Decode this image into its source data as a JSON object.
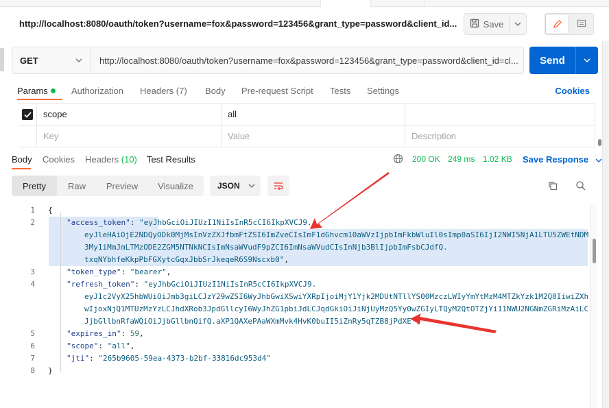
{
  "title_url": "http://localhost:8080/oauth/token?username=fox&password=123456&grant_type=password&client_id...",
  "toolbar": {
    "save_label": "Save"
  },
  "request": {
    "method": "GET",
    "url": "http://localhost:8080/oauth/token?username=fox&password=123456&grant_type=password&client_id=cl...",
    "send_label": "Send"
  },
  "request_tabs": {
    "params": "Params",
    "authorization": "Authorization",
    "headers": "Headers",
    "headers_count": "(7)",
    "body": "Body",
    "prerequest": "Pre-request Script",
    "tests": "Tests",
    "settings": "Settings",
    "cookies": "Cookies"
  },
  "params": {
    "rows": [
      {
        "key": "scope",
        "value": "all",
        "description": ""
      }
    ],
    "placeholders": {
      "key": "Key",
      "value": "Value",
      "description": "Description"
    }
  },
  "response_tabs": {
    "body": "Body",
    "cookies": "Cookies",
    "headers": "Headers",
    "headers_count": "(10)",
    "test_results": "Test Results"
  },
  "response_status": {
    "status": "200 OK",
    "time": "249 ms",
    "size": "1.02 KB",
    "save_response": "Save Response"
  },
  "view_modes": {
    "pretty": "Pretty",
    "raw": "Raw",
    "preview": "Preview",
    "visualize": "Visualize",
    "format": "JSON"
  },
  "colors": {
    "accent": "#ff6c37",
    "send": "#0265d2",
    "status_ok": "#0cbb52",
    "highlight": "#dde9f8",
    "arrow": "#e8342e"
  },
  "code": {
    "line_numbers": [
      "1",
      "2",
      "3",
      "4",
      "5",
      "6",
      "7",
      "8"
    ],
    "open_brace": "{",
    "close_brace": "}",
    "access_key": "\"access_token\"",
    "access_lines": [
      "\"eyJhbGciOiJIUzI1NiIsInR5cCI6IkpXVCJ9.",
      "eyJleHAiOjE2NDQyODk0MjMsInVzZXJfbmFtZSI6ImZveCIsImF1dGhvcm10aWVzIjpbImFkbWluIl0sImp0aSI6IjI2NWI5NjA1LTU5ZWEtNDM",
      "3My1iMmJmLTMzODE2ZGM5NTNkNCIsImNsaWVudF9pZCI6ImNsaWVudCIsInNjb3BlIjpbImFsbCJdfQ.",
      "txqNYbhfeKkpPbFGXytcGqxJbbSrJkeqeR6S9Nscxb0\""
    ],
    "token_type_key": "\"token_type\"",
    "token_type_value": "\"bearer\"",
    "refresh_key": "\"refresh_token\"",
    "refresh_lines": [
      "\"eyJhbGciOiJIUzI1NiIsInR5cCI6IkpXVCJ9.",
      "eyJ1c2VyX25hbWUiOiJmb3giLCJzY29wZSI6WyJhbGwiXSwiYXRpIjoiMjY1Yjk2MDUtNTllYS00MzczLWIyYmYtMzM4MTZkYzk1M2Q0IiwiZXh",
      "wIjoxNjQ1MTUzMzYzLCJhdXRob3JpdGllcyI6WyJhZG1pbiJdLCJqdGkiOiJiNjUyMzQ5Yy0wZGIyLTQyM2QtOTZjYi11NWU2NGNmZGRiMzAiLC",
      "JjbGllbnRfaWQiOiJjbGllbnQifQ.aXP1QAXePAaWXmMvk4HvK0buII5iZnRy5qTZB8jPdXE\""
    ],
    "expires_key": "\"expires_in\"",
    "expires_value": "59",
    "scope_key": "\"scope\"",
    "scope_value": "\"all\"",
    "jti_key": "\"jti\"",
    "jti_value": "\"265b9605-59ea-4373-b2bf-33816dc953d4\""
  }
}
